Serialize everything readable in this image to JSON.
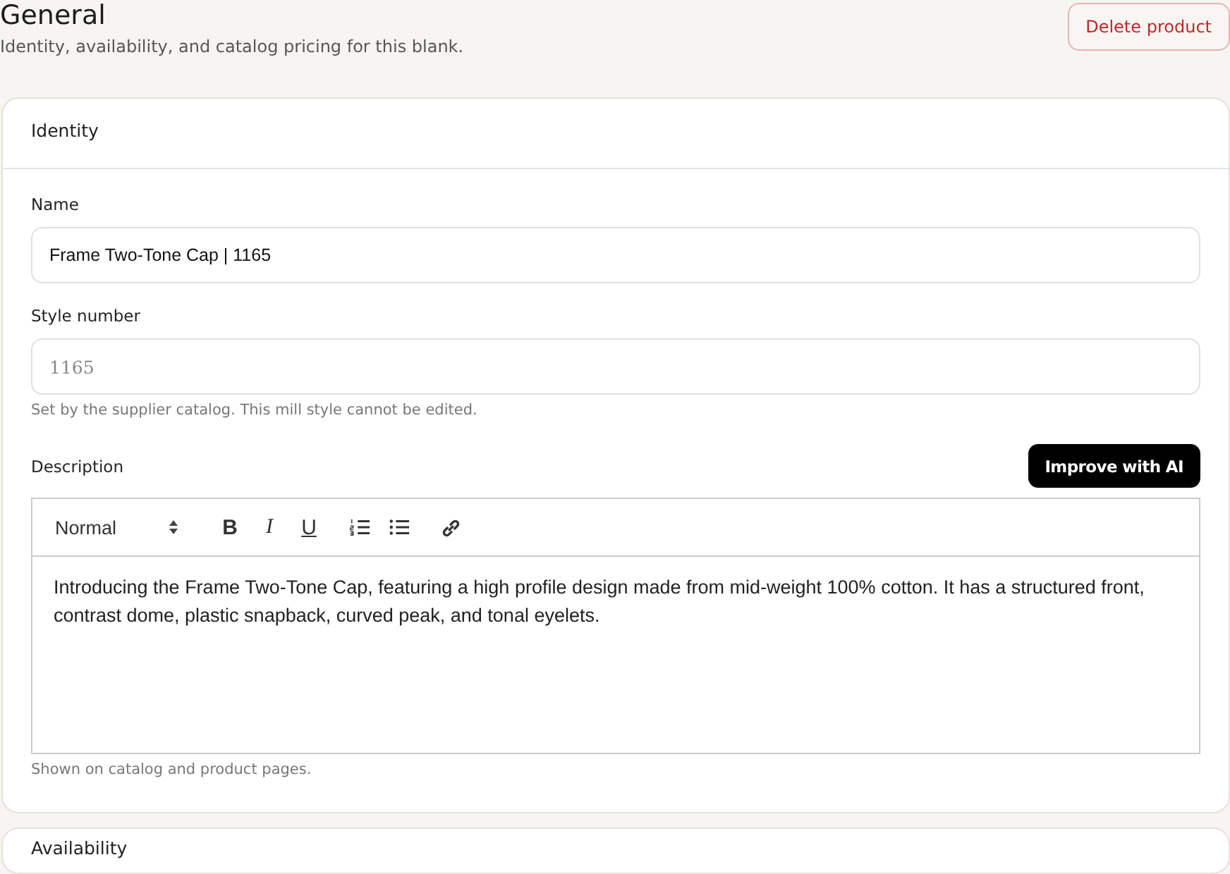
{
  "header": {
    "title": "General",
    "subtitle": "Identity, availability, and catalog pricing for this blank.",
    "delete_button": "Delete product"
  },
  "identity": {
    "title": "Identity",
    "name": {
      "label": "Name",
      "value": "Frame Two-Tone Cap | 1165",
      "disabled": false
    },
    "style_number": {
      "label": "Style number",
      "value": "1165",
      "disabled": true,
      "hint": "Set by the supplier catalog. This mill style cannot be edited."
    },
    "description": {
      "label": "Description",
      "ai_button": "Improve with AI",
      "format": "Normal",
      "toolbar": [
        {
          "kind": "bold",
          "glyph": "B"
        },
        {
          "kind": "italic",
          "glyph": "I"
        },
        {
          "kind": "underline",
          "glyph": "U"
        },
        {
          "kind": "ordered-list"
        },
        {
          "kind": "bullet-list"
        },
        {
          "kind": "link"
        }
      ],
      "text": "Introducing the Frame Two-Tone Cap, featuring a high profile design made from mid-weight 100% cotton. It has a structured front, contrast dome, plastic snapback, curved peak, and tonal eyelets.",
      "hint": "Shown on catalog and product pages."
    }
  },
  "availability": {
    "title": "Availability"
  }
}
